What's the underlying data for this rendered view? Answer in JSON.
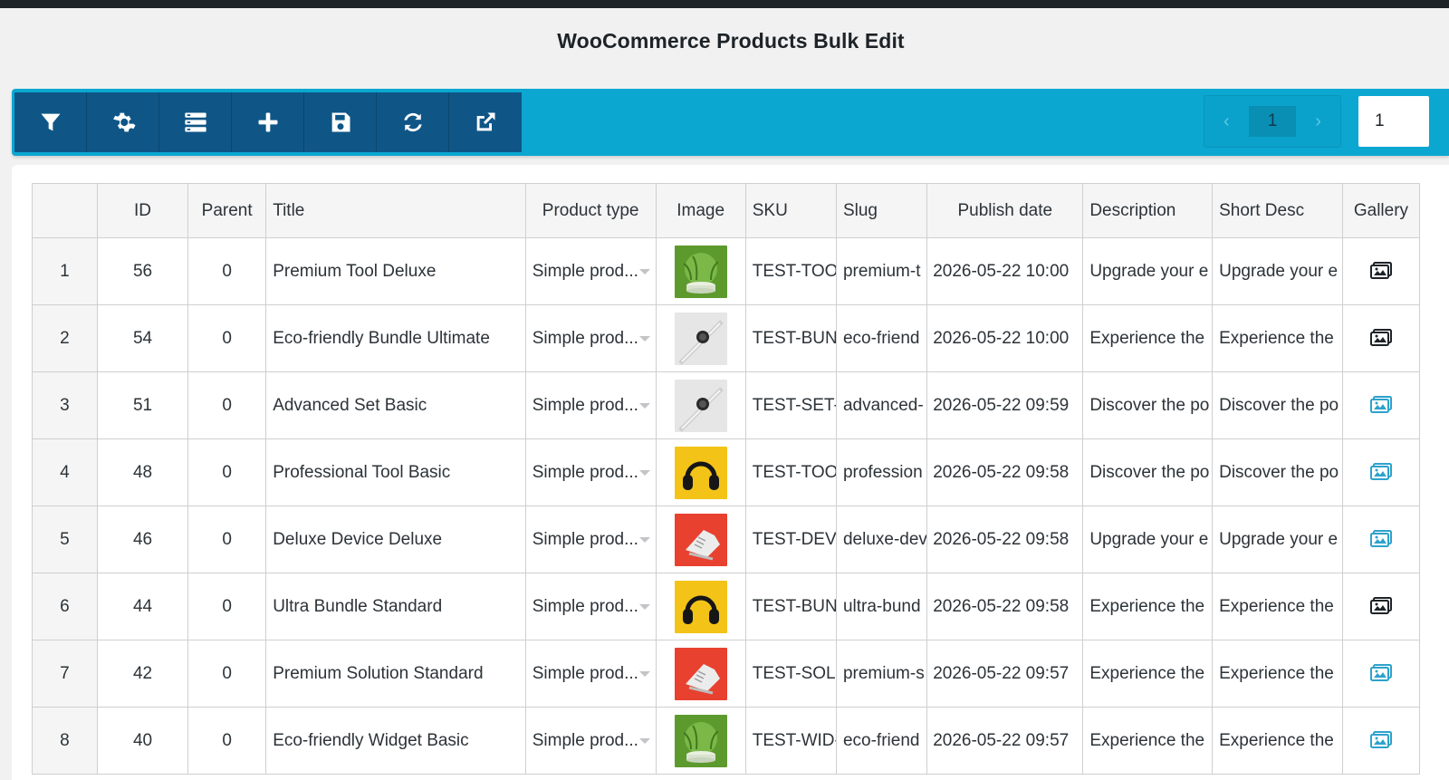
{
  "page": {
    "title": "WooCommerce Products Bulk Edit"
  },
  "toolbar": {
    "buttons": [
      {
        "icon": "filter-icon"
      },
      {
        "icon": "gear-icon"
      },
      {
        "icon": "columns-icon"
      },
      {
        "icon": "plus-icon"
      },
      {
        "icon": "save-icon"
      },
      {
        "icon": "refresh-icon"
      },
      {
        "icon": "external-link-icon"
      }
    ],
    "pager": {
      "prev": "‹",
      "current": "1",
      "next": "›"
    },
    "page_input_value": "1"
  },
  "colors": {
    "toolbar_bg": "#0ba7d1",
    "toolbar_group_bg": "#0f5687",
    "gallery_dark": "#1d2327",
    "gallery_blue": "#2ea2cc"
  },
  "grid": {
    "columns": [
      "",
      "ID",
      "Parent",
      "Title",
      "Product type",
      "Image",
      "SKU",
      "Slug",
      "Publish date",
      "Description",
      "Short Desc",
      "Gallery"
    ],
    "rows": [
      {
        "n": "1",
        "id": "56",
        "parent": "0",
        "title": "Premium Tool Deluxe",
        "type": "Simple prod...",
        "image": "green-podium",
        "sku": "TEST-TOO",
        "slug": "premium-t",
        "date": "2026-05-22 10:00",
        "desc": "Upgrade your e",
        "short": "Upgrade your e",
        "gallery": "dark"
      },
      {
        "n": "2",
        "id": "54",
        "parent": "0",
        "title": "Eco-friendly Bundle Ultimate",
        "type": "Simple prod...",
        "image": "smartwatch",
        "sku": "TEST-BUN",
        "slug": "eco-friend",
        "date": "2026-05-22 10:00",
        "desc": "Experience the",
        "short": "Experience the",
        "gallery": "dark"
      },
      {
        "n": "3",
        "id": "51",
        "parent": "0",
        "title": "Advanced Set Basic",
        "type": "Simple prod...",
        "image": "smartwatch",
        "sku": "TEST-SET-",
        "slug": "advanced-",
        "date": "2026-05-22 09:59",
        "desc": "Discover the po",
        "short": "Discover the po",
        "gallery": "blue"
      },
      {
        "n": "4",
        "id": "48",
        "parent": "0",
        "title": "Professional Tool Basic",
        "type": "Simple prod...",
        "image": "headphones",
        "sku": "TEST-TOO",
        "slug": "profession",
        "date": "2026-05-22 09:58",
        "desc": "Discover the po",
        "short": "Discover the po",
        "gallery": "blue"
      },
      {
        "n": "5",
        "id": "46",
        "parent": "0",
        "title": "Deluxe Device Deluxe",
        "type": "Simple prod...",
        "image": "sneaker",
        "sku": "TEST-DEV-",
        "slug": "deluxe-dev",
        "date": "2026-05-22 09:58",
        "desc": "Upgrade your e",
        "short": "Upgrade your e",
        "gallery": "blue"
      },
      {
        "n": "6",
        "id": "44",
        "parent": "0",
        "title": "Ultra Bundle Standard",
        "type": "Simple prod...",
        "image": "headphones",
        "sku": "TEST-BUN",
        "slug": "ultra-bund",
        "date": "2026-05-22 09:58",
        "desc": "Experience the",
        "short": "Experience the",
        "gallery": "dark"
      },
      {
        "n": "7",
        "id": "42",
        "parent": "0",
        "title": "Premium Solution Standard",
        "type": "Simple prod...",
        "image": "sneaker",
        "sku": "TEST-SOL-",
        "slug": "premium-s",
        "date": "2026-05-22 09:57",
        "desc": "Experience the",
        "short": "Experience the",
        "gallery": "blue"
      },
      {
        "n": "8",
        "id": "40",
        "parent": "0",
        "title": "Eco-friendly Widget Basic",
        "type": "Simple prod...",
        "image": "green-podium",
        "sku": "TEST-WID-",
        "slug": "eco-friend",
        "date": "2026-05-22 09:57",
        "desc": "Experience the",
        "short": "Experience the",
        "gallery": "blue"
      }
    ]
  }
}
